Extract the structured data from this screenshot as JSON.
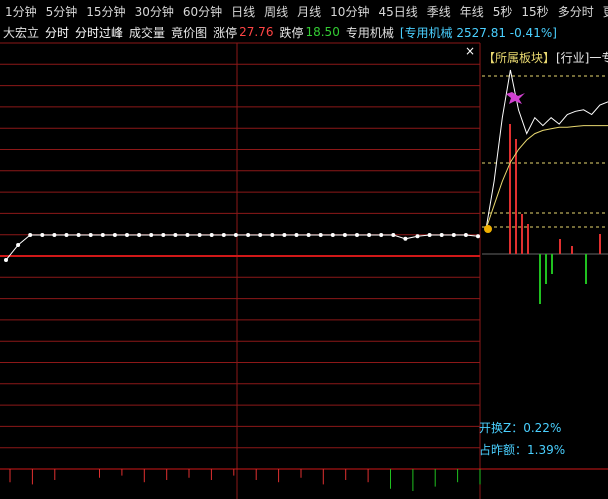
{
  "tabs": [
    "1分钟",
    "5分钟",
    "15分钟",
    "30分钟",
    "60分钟",
    "日线",
    "周线",
    "月线",
    "10分钟",
    "45日线",
    "季线",
    "年线",
    "5秒",
    "15秒",
    "多分时",
    "更"
  ],
  "stock": {
    "name": "大宏立",
    "mode_intraday": "分时",
    "mode_overlay": "分时过峰",
    "option_volume": "成交量",
    "option_auction": "竟价图",
    "limit_up_label": "涨停",
    "limit_up_value": "27.76",
    "limit_down_label": "跌停",
    "limit_down_value": "18.50",
    "sector_name": "专用机械",
    "sector_quote": "[专用机械 2527.81 -0.41%]"
  },
  "panel": {
    "close_symbol": "×",
    "sector_title": "【所属板块】",
    "industry_tag": "[行业]一专",
    "open_turnover": "开换Z：0.22%",
    "prev_amount": "占昨额：1.39%"
  },
  "colors": {
    "grid_red": "#8c1818",
    "baseline": "#d01818",
    "price_line": "#ffffff",
    "volume_up": "#e03030",
    "volume_down": "#20c020",
    "cyan_text": "#4ad0ff",
    "dashed_yellow": "#e8d870"
  },
  "chart_data": {
    "type": "line",
    "title": "",
    "xlabel": "",
    "ylabel": "",
    "series": [
      {
        "values": [
          0.0,
          0.6,
          1.0,
          1.0,
          1.0,
          1.0,
          1.0,
          1.0,
          1.0,
          1.0,
          1.0,
          1.0,
          1.0,
          1.0,
          1.0,
          1.0,
          1.0,
          1.0,
          1.0,
          1.0,
          1.0,
          1.0,
          1.0,
          1.0,
          1.0,
          1.0,
          1.0,
          1.0,
          1.0,
          1.0,
          1.0,
          1.0,
          1.0,
          0.85,
          0.95,
          1.0,
          1.0,
          1.0,
          1.0,
          0.95
        ]
      }
    ],
    "volume_bars": [
      -0.6,
      -0.7,
      -0.5,
      0,
      -0.4,
      -0.3,
      -0.6,
      -0.5,
      -0.4,
      -0.5,
      -0.3,
      -0.5,
      -0.6,
      -0.4,
      -0.7,
      -0.5,
      -0.6,
      -0.9,
      -1.0,
      -0.8,
      -0.6,
      -0.7
    ],
    "right_panel_series": [
      {
        "values": [
          0.0,
          0.3,
          0.7,
          1.0,
          0.75,
          0.6,
          0.7,
          0.65,
          0.7,
          0.66,
          0.72,
          0.74,
          0.75,
          0.72,
          0.78,
          0.8
        ]
      },
      {
        "values": [
          0.0,
          0.15,
          0.3,
          0.42,
          0.5,
          0.56,
          0.6,
          0.62,
          0.63,
          0.64,
          0.64,
          0.645,
          0.65,
          0.65,
          0.65,
          0.65
        ]
      }
    ]
  }
}
